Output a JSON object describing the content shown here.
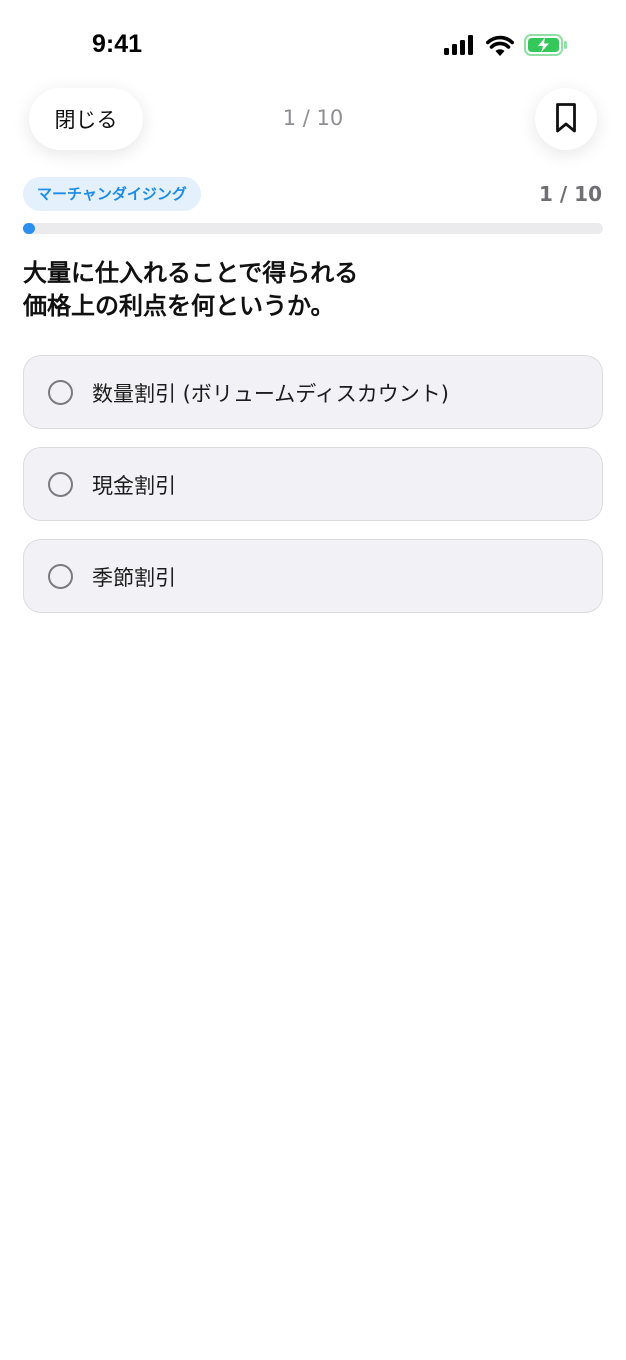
{
  "status_bar": {
    "time": "9:41",
    "icons": [
      "signal-icon",
      "wifi-icon",
      "battery-charging-icon"
    ]
  },
  "nav": {
    "close_label": "閉じる",
    "counter": "1 / 10",
    "bookmark_icon": "bookmark-icon"
  },
  "quiz": {
    "category": "マーチャンダイジング",
    "progress_label": "1 / 10",
    "progress_fraction": 0.02,
    "question_line1": "大量に仕入れることで得られる",
    "question_line2": "価格上の利点を何というか。",
    "options": [
      {
        "label": "数量割引 (ボリュームディスカウント)",
        "selected": false
      },
      {
        "label": "現金割引",
        "selected": false
      },
      {
        "label": "季節割引",
        "selected": false
      }
    ]
  },
  "colors": {
    "accent": "#2a8ff0",
    "badge_bg": "#e4f1fd",
    "option_bg": "#f2f2f6",
    "battery_green": "#34c759"
  }
}
